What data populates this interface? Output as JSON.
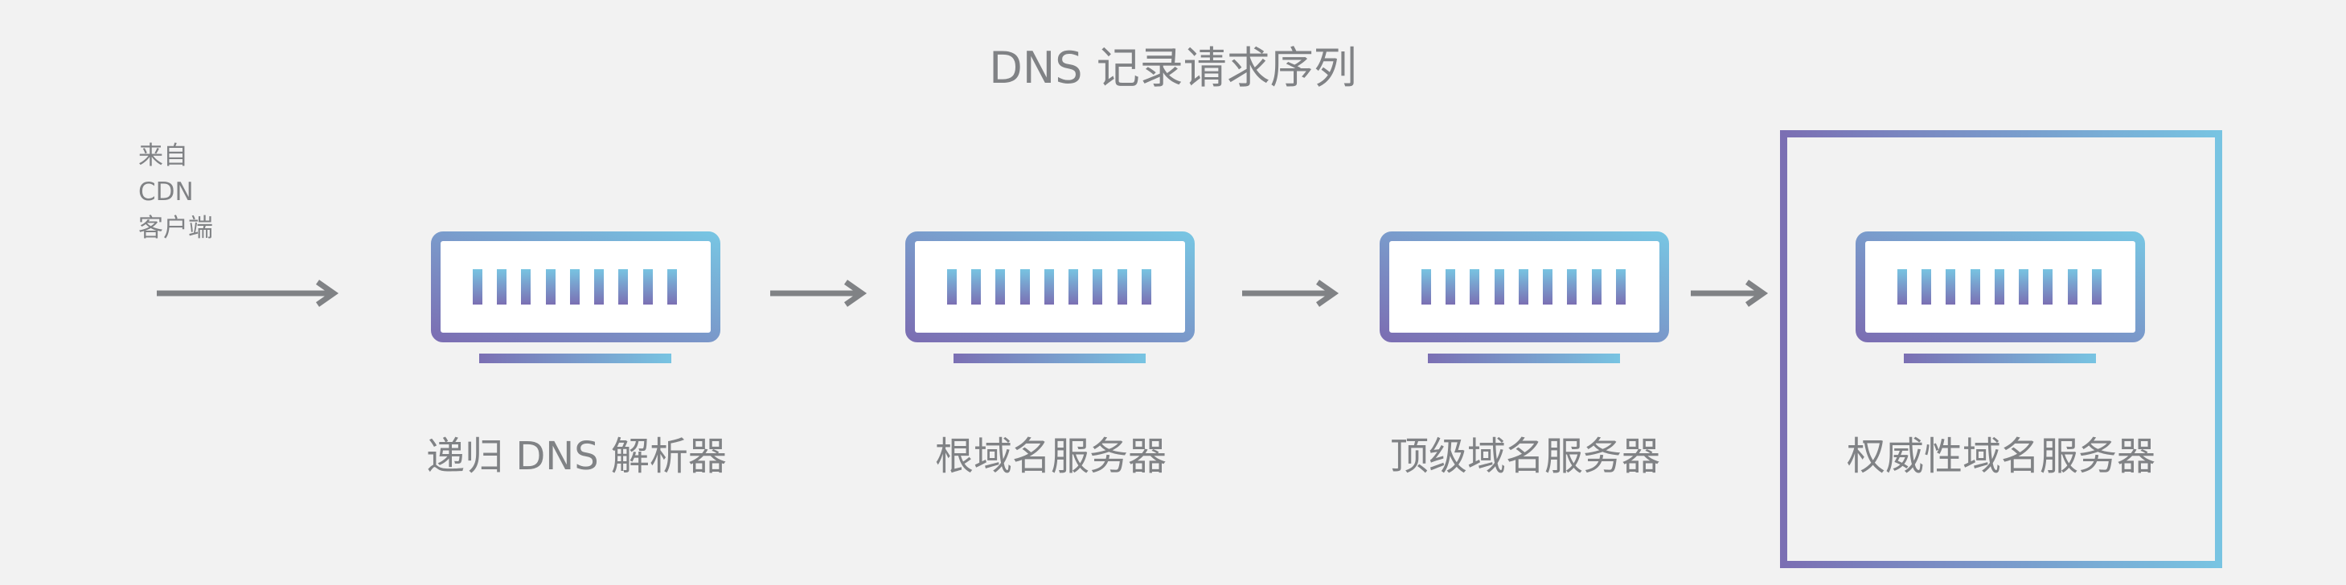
{
  "title": "DNS 记录请求序列",
  "client": {
    "line1": "来自",
    "line2": "CDN",
    "line3": "客户端"
  },
  "servers": [
    {
      "label": "递归 DNS 解析器"
    },
    {
      "label": "根域名服务器"
    },
    {
      "label": "顶级域名服务器"
    },
    {
      "label": "权威性域名服务器",
      "highlighted": true
    }
  ],
  "colors": {
    "background": "#f2f2f2",
    "text": "#808285",
    "arrow": "#808285",
    "gradient_start": "#7b6fb3",
    "gradient_end": "#78c4e2"
  },
  "icons": {
    "server": "server-icon",
    "arrow": "arrow-right-icon"
  }
}
